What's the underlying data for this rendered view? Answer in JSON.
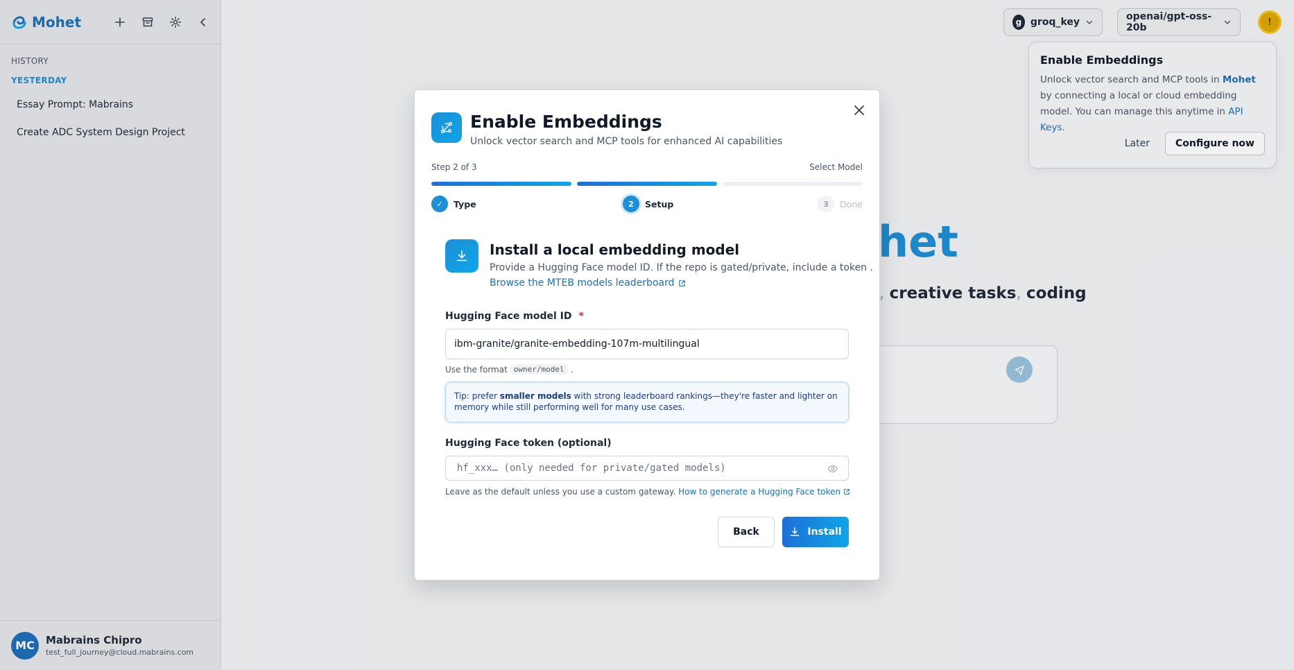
{
  "app": {
    "name": "Mohet"
  },
  "sidebar": {
    "history_label": "HISTORY",
    "group_label": "YESTERDAY",
    "items": [
      {
        "label": "Essay Prompt: Mabrains"
      },
      {
        "label": "Create ADC System Design Project"
      }
    ],
    "user": {
      "initials": "MC",
      "name": "Mabrains Chipro",
      "email": "test_full_journey@cloud.mabrains.com"
    }
  },
  "topbar": {
    "provider_key": "groq_key",
    "provider_badge": "g",
    "model": "openai/gpt-oss-20b",
    "notif_badge": "!"
  },
  "hero": {
    "title_fragment": "het",
    "sub_1": ", ",
    "sub_2": "creative tasks",
    "sub_3": ", ",
    "sub_4": "coding"
  },
  "notification": {
    "title": "Enable Embeddings",
    "text_1": "Unlock vector search and MCP tools in ",
    "text_brand": "Mohet",
    "text_2": " by connecting a local or cloud embedding model. You can manage this anytime in ",
    "text_link": "API Keys",
    "text_3": ".",
    "later_label": "Later",
    "configure_label": "Configure now"
  },
  "modal": {
    "title": "Enable Embeddings",
    "subtitle": "Unlock vector search and MCP tools for enhanced AI capabilities",
    "step_text": "Step 2 of 3",
    "step_name": "Select Model",
    "progress": [
      1,
      1,
      0
    ],
    "steps": [
      {
        "badge": "✓",
        "label": "Type",
        "state": "done"
      },
      {
        "badge": "2",
        "label": "Setup",
        "state": "active"
      },
      {
        "badge": "3",
        "label": "Done",
        "state": "todo"
      }
    ],
    "section": {
      "title": "Install a local embedding model",
      "desc": "Provide a Hugging Face model ID. If the repo is gated/private, include a token .",
      "link": "Browse the MTEB models leaderboard"
    },
    "model_field": {
      "label": "Hugging Face model ID",
      "required_mark": "*",
      "value": "ibm-granite/granite-embedding-107m-multilingual",
      "hint_prefix": "Use the format",
      "hint_code": "owner/model",
      "hint_suffix": "."
    },
    "tip": {
      "prefix": "Tip: prefer ",
      "bold": "smaller models",
      "suffix": " with strong leaderboard rankings—they're faster and lighter on memory while still performing well for many use cases."
    },
    "token_field": {
      "label": "Hugging Face token (optional)",
      "placeholder": "hf_xxx… (only needed for private/gated models)",
      "hint": "Leave as the default unless you use a custom gateway.",
      "hint_link": "How to generate a Hugging Face token"
    },
    "back_label": "Back",
    "install_label": "Install"
  },
  "colors": {
    "brand": "#1d8fd6",
    "accent_link": "#1d6fb8",
    "required": "#e11d48",
    "notif": "#e0a800"
  }
}
